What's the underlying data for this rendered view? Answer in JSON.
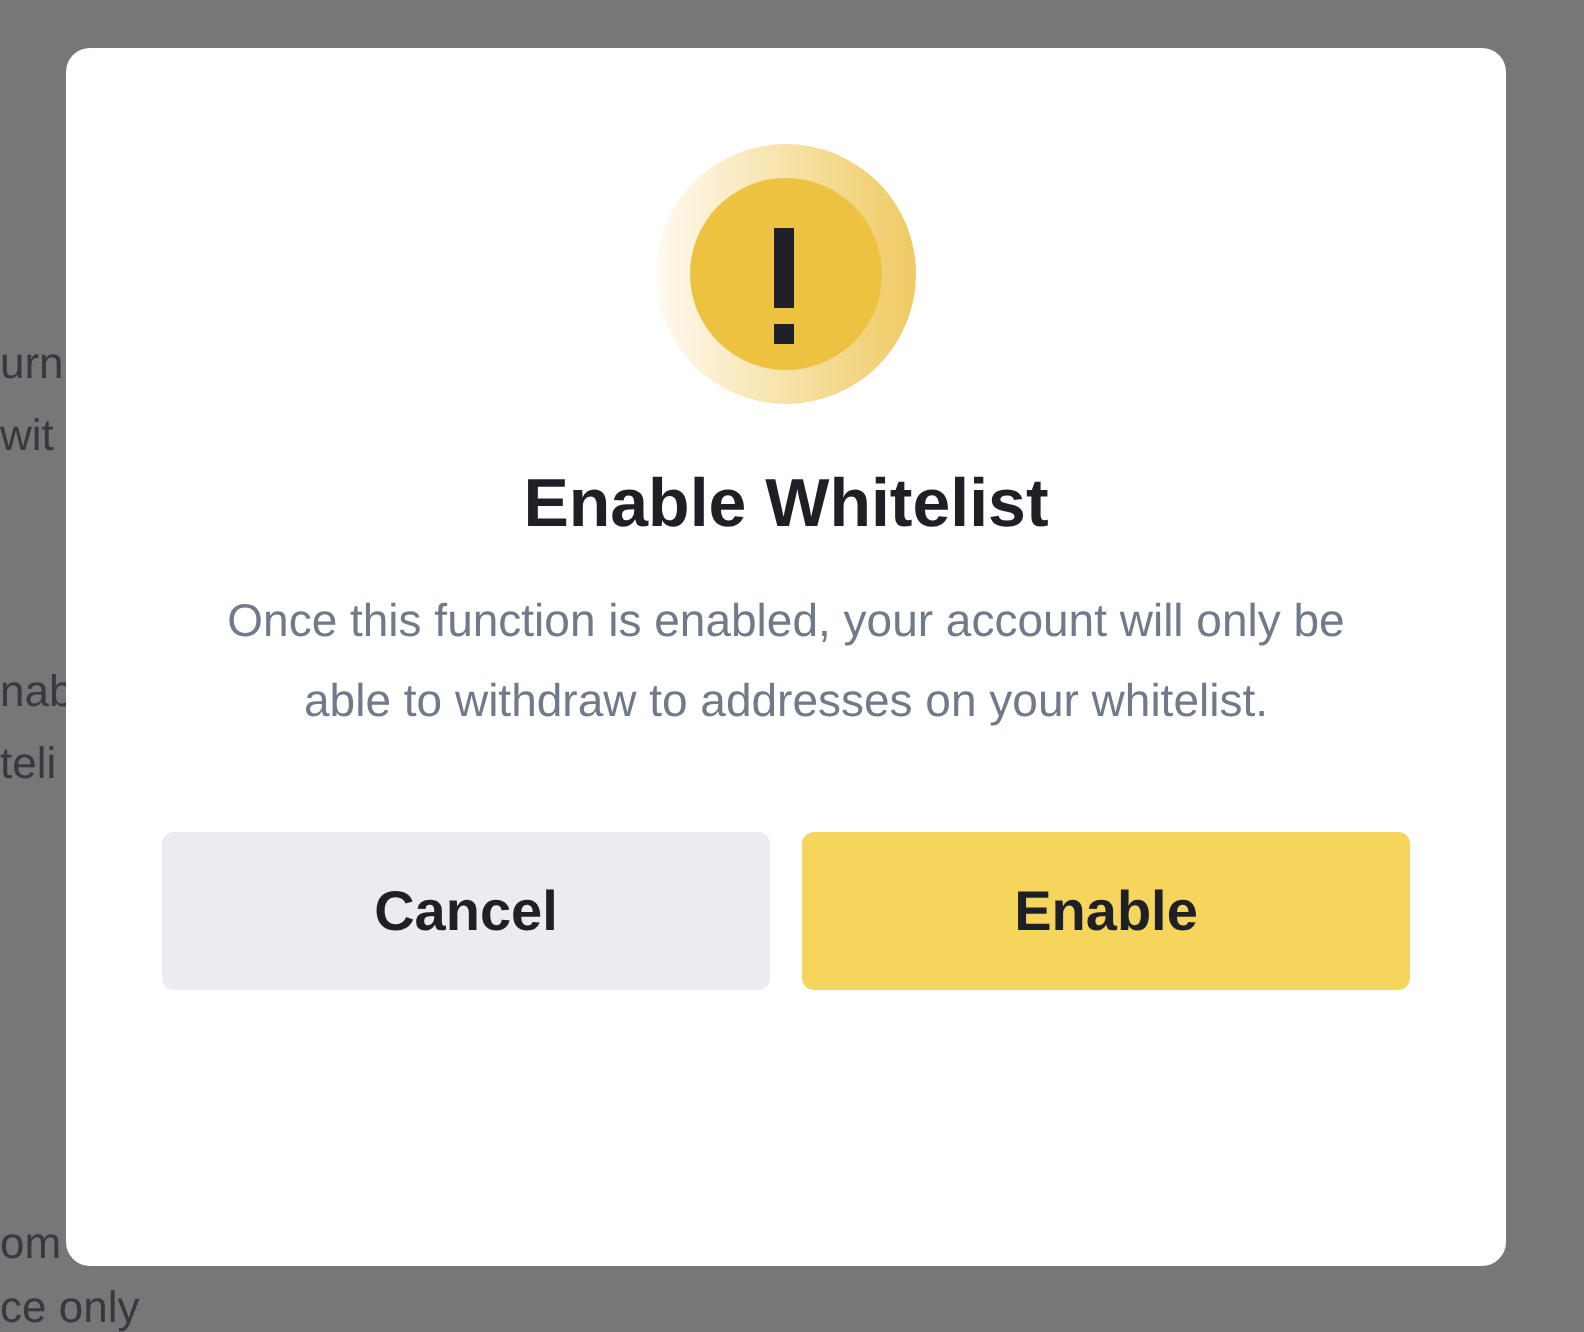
{
  "background_page": {
    "fragments": [
      "urn",
      "wit",
      "nab",
      "teli",
      "om",
      "ce only"
    ]
  },
  "dialog": {
    "title": "Enable Whitelist",
    "message": "Once this function is enabled, your account will only be able to withdraw to addresses on your whitelist.",
    "buttons": [
      {
        "label": "Cancel",
        "kind": "secondary"
      },
      {
        "label": "Enable",
        "kind": "primary"
      }
    ]
  }
}
